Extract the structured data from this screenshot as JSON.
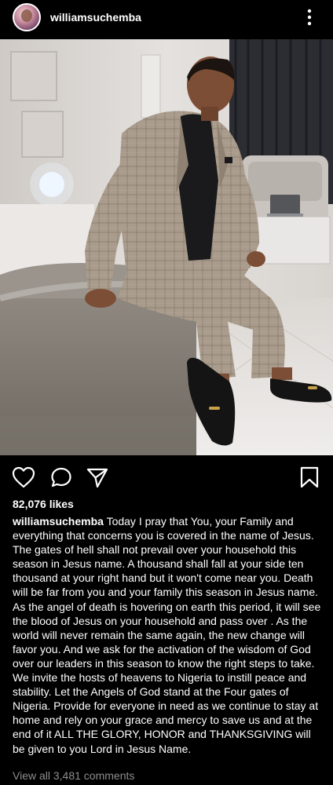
{
  "header": {
    "username": "williamsuchemba",
    "avatar_icon": "profile-avatar",
    "more_icon": "vertical-ellipsis-icon"
  },
  "post": {
    "likes": "82,076 likes",
    "caption_user": "williamsuchemba",
    "caption_text": " Today I pray that You, your Family and everything that concerns you is covered in the name of Jesus. The gates of hell shall not prevail over your household this season in Jesus name. A thousand shall fall at your side ten thousand at your right hand but it won't come near you. Death will be far from you and your family this season in Jesus name. As the angel of death is hovering on earth this period, it will see the blood of Jesus on your household and pass over . As the world will never remain the same again, the new change will favor you. And we ask for the activation of the wisdom of God over our leaders in this season to know the right steps to take. We invite the hosts of heavens to Nigeria to instill peace and stability. Let the Angels of God stand at the Four gates of Nigeria. Provide for everyone in need as we continue to stay at home and rely on your grace and mercy to save us and  at the end of it  ALL THE GLORY, HONOR and THANKSGIVING will be given to you Lord in Jesus Name.",
    "view_comments": "View all 3,481 comments"
  },
  "icons": {
    "like": "heart-outline-icon",
    "comment": "speech-bubble-icon",
    "share": "paper-plane-icon",
    "save": "bookmark-outline-icon"
  },
  "colors": {
    "background": "#000000",
    "text": "#ffffff",
    "muted": "#8e8e8e"
  }
}
